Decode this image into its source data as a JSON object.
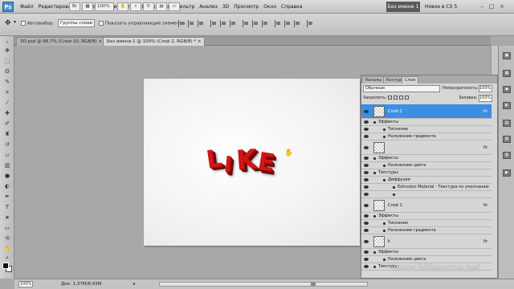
{
  "app": {
    "logo": "Ps",
    "workspace_button": "Без имени 1",
    "new_in": "Новое в CS 5"
  },
  "menu": [
    "Файл",
    "Редактирование",
    "Изображение",
    "Слои",
    "Выделение",
    "Фильтр",
    "Анализ",
    "3D",
    "Просмотр",
    "Окно",
    "Справка"
  ],
  "menubar_zoom": "100%",
  "window_controls": [
    "–",
    "□",
    "×"
  ],
  "options": {
    "autoselect_label": "Автовыбор:",
    "autoselect_value": "Группы слоев",
    "show_controls_label": "Показать управляющие элементы"
  },
  "tabs": [
    {
      "label": "3D.psd @ 66,7% (Слой 10, RGB/8)",
      "close": "×"
    },
    {
      "label": "Без имени-1 @ 100% (Слой 2, RGB/8) *",
      "close": "×"
    }
  ],
  "canvas": {
    "text_letters": [
      "L",
      "I",
      "K",
      "E"
    ],
    "text_color": "#d11616"
  },
  "layers_panel": {
    "tabs": [
      "Каналы",
      "Контуры",
      "Слои"
    ],
    "blend_mode": "Обычные",
    "opacity_label": "Непрозрачность:",
    "opacity_value": "100%",
    "lock_label": "Закрепить:",
    "fill_label": "Заливка:",
    "fill_value": "100%",
    "fx": "fx",
    "rows": [
      {
        "kind": "layer",
        "name": "Слой 2",
        "selected": true
      },
      {
        "kind": "sub",
        "text": "Эффекты"
      },
      {
        "kind": "sub2",
        "text": "Тиснение"
      },
      {
        "kind": "sub2",
        "text": "Наложение градиента"
      },
      {
        "kind": "layer",
        "name": "",
        "selected": false
      },
      {
        "kind": "sub",
        "text": "Эффекты"
      },
      {
        "kind": "sub2",
        "text": "Наложение цвета"
      },
      {
        "kind": "sub",
        "text": "Текстуры"
      },
      {
        "kind": "sub2",
        "text": "Диффузия"
      },
      {
        "kind": "sub3",
        "text": "Extrusion Material - Текстура по умолчанию"
      },
      {
        "kind": "sub3",
        "text": ""
      },
      {
        "kind": "layer",
        "name": "Слой 1",
        "selected": false
      },
      {
        "kind": "sub",
        "text": "Эффекты"
      },
      {
        "kind": "sub2",
        "text": "Тиснение"
      },
      {
        "kind": "sub2",
        "text": "Наложение градиента"
      },
      {
        "kind": "layer",
        "name": "k",
        "selected": false
      },
      {
        "kind": "sub",
        "text": "Эффекты"
      },
      {
        "kind": "sub2",
        "text": "Наложение цвета"
      },
      {
        "kind": "sub",
        "text": "Текстуры"
      }
    ]
  },
  "status": {
    "zoom": "100%",
    "doc": "Док: 1,37M/8,43M"
  },
  "watermark": "www.MSsource.net"
}
